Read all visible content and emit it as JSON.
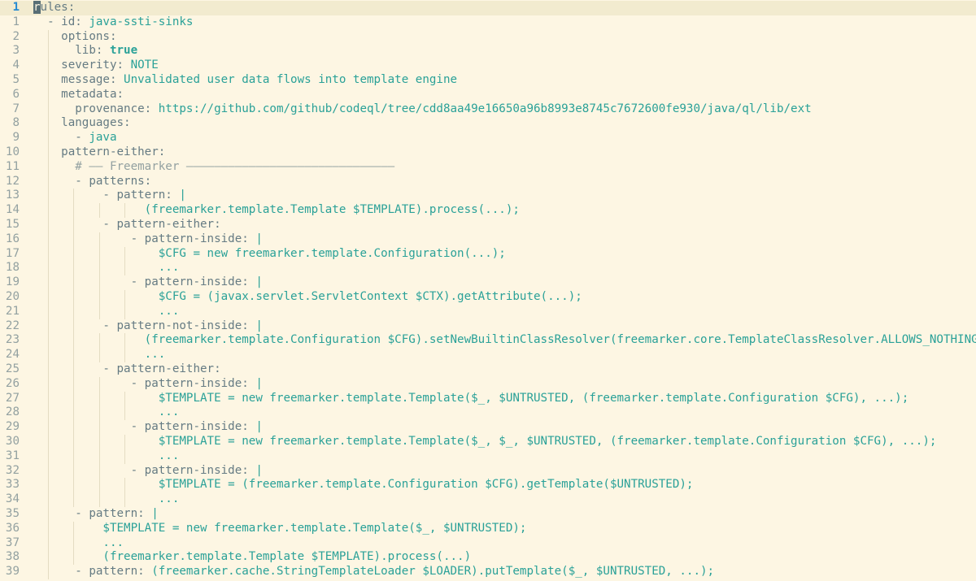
{
  "editor": {
    "lines": [
      {
        "n": "1",
        "indent": 0,
        "segs": [
          {
            "t": "r",
            "c": "cursor"
          },
          {
            "t": "ules:",
            "c": "k"
          }
        ]
      },
      {
        "n": "1",
        "indent": 1,
        "segs": [
          {
            "t": "- id: ",
            "c": "k"
          },
          {
            "t": "java-ssti-sinks",
            "c": "v"
          }
        ]
      },
      {
        "n": "2",
        "indent": 2,
        "segs": [
          {
            "t": "options:",
            "c": "k"
          }
        ]
      },
      {
        "n": "3",
        "indent": 3,
        "segs": [
          {
            "t": "lib: ",
            "c": "k"
          },
          {
            "t": "true",
            "c": "b"
          }
        ]
      },
      {
        "n": "4",
        "indent": 2,
        "segs": [
          {
            "t": "severity: ",
            "c": "k"
          },
          {
            "t": "NOTE",
            "c": "v"
          }
        ]
      },
      {
        "n": "5",
        "indent": 2,
        "segs": [
          {
            "t": "message: ",
            "c": "k"
          },
          {
            "t": "Unvalidated user data flows into template engine",
            "c": "v"
          }
        ]
      },
      {
        "n": "6",
        "indent": 2,
        "segs": [
          {
            "t": "metadata:",
            "c": "k"
          }
        ]
      },
      {
        "n": "7",
        "indent": 3,
        "segs": [
          {
            "t": "provenance: ",
            "c": "k"
          },
          {
            "t": "https://github.com/github/codeql/tree/cdd8aa49e16650a96b8993e8745c7672600fe930/java/ql/lib/ext",
            "c": "v"
          }
        ]
      },
      {
        "n": "8",
        "indent": 2,
        "segs": [
          {
            "t": "languages:",
            "c": "k"
          }
        ]
      },
      {
        "n": "9",
        "indent": 3,
        "segs": [
          {
            "t": "- ",
            "c": "k"
          },
          {
            "t": "java",
            "c": "v"
          }
        ]
      },
      {
        "n": "10",
        "indent": 2,
        "segs": [
          {
            "t": "pattern-either:",
            "c": "k"
          }
        ]
      },
      {
        "n": "11",
        "indent": 3,
        "segs": [
          {
            "t": "# —— Freemarker ——————————————————————————————",
            "c": "c"
          }
        ]
      },
      {
        "n": "12",
        "indent": 3,
        "segs": [
          {
            "t": "- patterns:",
            "c": "k"
          }
        ]
      },
      {
        "n": "13",
        "indent": 5,
        "segs": [
          {
            "t": "- pattern: ",
            "c": "k"
          },
          {
            "t": "|",
            "c": "v"
          }
        ]
      },
      {
        "n": "14",
        "indent": 8,
        "segs": [
          {
            "t": "(freemarker.template.Template $TEMPLATE).process(...);",
            "c": "v"
          }
        ]
      },
      {
        "n": "15",
        "indent": 5,
        "segs": [
          {
            "t": "- pattern-either:",
            "c": "k"
          }
        ]
      },
      {
        "n": "16",
        "indent": 7,
        "segs": [
          {
            "t": "- pattern-inside: ",
            "c": "k"
          },
          {
            "t": "|",
            "c": "v"
          }
        ]
      },
      {
        "n": "17",
        "indent": 9,
        "segs": [
          {
            "t": "$CFG = new freemarker.template.Configuration(...);",
            "c": "v"
          }
        ]
      },
      {
        "n": "18",
        "indent": 9,
        "segs": [
          {
            "t": "...",
            "c": "v"
          }
        ]
      },
      {
        "n": "19",
        "indent": 7,
        "segs": [
          {
            "t": "- pattern-inside: ",
            "c": "k"
          },
          {
            "t": "|",
            "c": "v"
          }
        ]
      },
      {
        "n": "20",
        "indent": 9,
        "segs": [
          {
            "t": "$CFG = (javax.servlet.ServletContext $CTX).getAttribute(...);",
            "c": "v"
          }
        ]
      },
      {
        "n": "21",
        "indent": 9,
        "segs": [
          {
            "t": "...",
            "c": "v"
          }
        ]
      },
      {
        "n": "22",
        "indent": 5,
        "segs": [
          {
            "t": "- pattern-not-inside: ",
            "c": "k"
          },
          {
            "t": "|",
            "c": "v"
          }
        ]
      },
      {
        "n": "23",
        "indent": 8,
        "segs": [
          {
            "t": "(freemarker.template.Configuration $CFG).setNewBuiltinClassResolver(freemarker.core.TemplateClassResolver.ALLOWS_NOTHING_RESOLVER);",
            "c": "v"
          }
        ]
      },
      {
        "n": "24",
        "indent": 8,
        "segs": [
          {
            "t": "...",
            "c": "v"
          }
        ]
      },
      {
        "n": "25",
        "indent": 5,
        "segs": [
          {
            "t": "- pattern-either:",
            "c": "k"
          }
        ]
      },
      {
        "n": "26",
        "indent": 7,
        "segs": [
          {
            "t": "- pattern-inside: ",
            "c": "k"
          },
          {
            "t": "|",
            "c": "v"
          }
        ]
      },
      {
        "n": "27",
        "indent": 9,
        "segs": [
          {
            "t": "$TEMPLATE = new freemarker.template.Template($_, $UNTRUSTED, (freemarker.template.Configuration $CFG), ...);",
            "c": "v"
          }
        ]
      },
      {
        "n": "28",
        "indent": 9,
        "segs": [
          {
            "t": "...",
            "c": "v"
          }
        ]
      },
      {
        "n": "29",
        "indent": 7,
        "segs": [
          {
            "t": "- pattern-inside: ",
            "c": "k"
          },
          {
            "t": "|",
            "c": "v"
          }
        ]
      },
      {
        "n": "30",
        "indent": 9,
        "segs": [
          {
            "t": "$TEMPLATE = new freemarker.template.Template($_, $_, $UNTRUSTED, (freemarker.template.Configuration $CFG), ...);",
            "c": "v"
          }
        ]
      },
      {
        "n": "31",
        "indent": 9,
        "segs": [
          {
            "t": "...",
            "c": "v"
          }
        ]
      },
      {
        "n": "32",
        "indent": 7,
        "segs": [
          {
            "t": "- pattern-inside: ",
            "c": "k"
          },
          {
            "t": "|",
            "c": "v"
          }
        ]
      },
      {
        "n": "33",
        "indent": 9,
        "segs": [
          {
            "t": "$TEMPLATE = (freemarker.template.Configuration $CFG).getTemplate($UNTRUSTED);",
            "c": "v"
          }
        ]
      },
      {
        "n": "34",
        "indent": 9,
        "segs": [
          {
            "t": "...",
            "c": "v"
          }
        ]
      },
      {
        "n": "35",
        "indent": 3,
        "segs": [
          {
            "t": "- pattern: ",
            "c": "k"
          },
          {
            "t": "|",
            "c": "v"
          }
        ]
      },
      {
        "n": "36",
        "indent": 5,
        "segs": [
          {
            "t": "$TEMPLATE = new freemarker.template.Template($_, $UNTRUSTED);",
            "c": "v"
          }
        ]
      },
      {
        "n": "37",
        "indent": 5,
        "segs": [
          {
            "t": "...",
            "c": "v"
          }
        ]
      },
      {
        "n": "38",
        "indent": 5,
        "segs": [
          {
            "t": "(freemarker.template.Template $TEMPLATE).process(...)",
            "c": "v"
          }
        ]
      },
      {
        "n": "39",
        "indent": 3,
        "segs": [
          {
            "t": "- pattern: ",
            "c": "k"
          },
          {
            "t": "(freemarker.cache.StringTemplateLoader $LOADER).putTemplate($_, $UNTRUSTED, ...);",
            "c": "v"
          }
        ]
      }
    ]
  }
}
